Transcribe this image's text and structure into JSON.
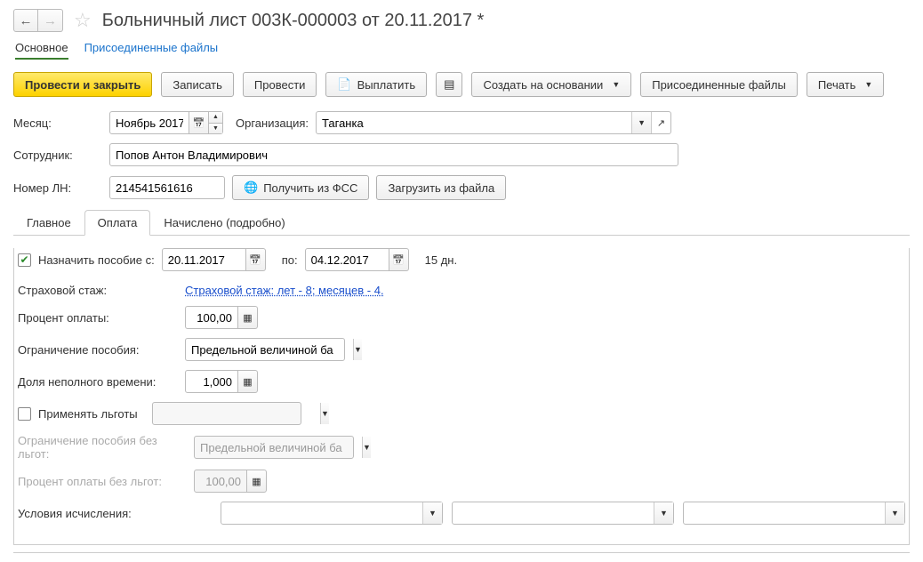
{
  "header": {
    "title": "Больничный лист 003К-000003 от 20.11.2017 *"
  },
  "primaryTabs": {
    "main": "Основное",
    "attached": "Присоединенные файлы"
  },
  "toolbar": {
    "postAndClose": "Провести и закрыть",
    "save": "Записать",
    "post": "Провести",
    "pay": "Выплатить",
    "createBased": "Создать на основании",
    "attachedFiles": "Присоединенные файлы",
    "print": "Печать"
  },
  "fields": {
    "monthLabel": "Месяц:",
    "monthValue": "Ноябрь 2017",
    "orgLabel": "Организация:",
    "orgValue": "Таганка",
    "employeeLabel": "Сотрудник:",
    "employeeValue": "Попов Антон Владимирович",
    "lnNumberLabel": "Номер ЛН:",
    "lnNumberValue": "214541561616",
    "getFromFss": "Получить из ФСС",
    "loadFromFile": "Загрузить из файла"
  },
  "secondaryTabs": {
    "main": "Главное",
    "payment": "Оплата",
    "accrued": "Начислено (подробно)"
  },
  "paymentTab": {
    "assignBenefitLabel": "Назначить пособие с:",
    "dateFrom": "20.11.2017",
    "toLabel": "по:",
    "dateTo": "04.12.2017",
    "days": "15 дн.",
    "insuranceLabel": "Страховой стаж:",
    "insuranceLink": "Страховой стаж: лет - 8; месяцев - 4.",
    "payPercentLabel": "Процент оплаты:",
    "payPercentValue": "100,00",
    "benefitLimitLabel": "Ограничение пособия:",
    "benefitLimitValue": "Предельной величиной ба",
    "partTimeLabel": "Доля неполного времени:",
    "partTimeValue": "1,000",
    "applyBenefitsLabel": "Применять льготы",
    "limitNoBenefitsLabel": "Ограничение пособия без льгот:",
    "limitNoBenefitsValue": "Предельной величиной ба",
    "percentNoBenefitsLabel": "Процент оплаты без льгот:",
    "percentNoBenefitsValue": "100,00",
    "conditionsLabel": "Условия исчисления:"
  }
}
